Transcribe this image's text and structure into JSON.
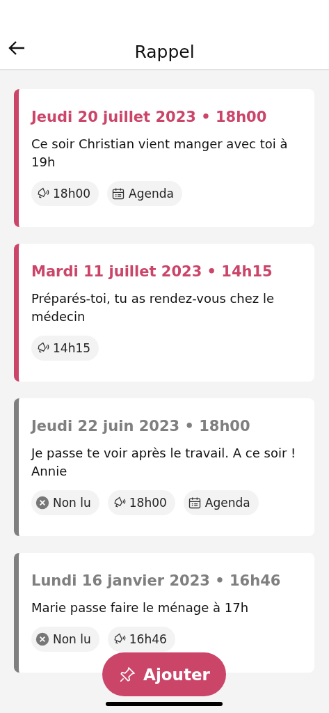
{
  "header": {
    "title": "Rappel"
  },
  "reminders": [
    {
      "date": "Jeudi 20 juillet 2023 • 18h00",
      "message": "Ce soir Christian vient manger avec toi à 19h",
      "active": true,
      "chips": [
        {
          "kind": "alarm",
          "label": "18h00"
        },
        {
          "kind": "agenda",
          "label": "Agenda"
        }
      ]
    },
    {
      "date": "Mardi 11 juillet 2023 • 14h15",
      "message": "Préparés-toi, tu as rendez-vous chez le médecin",
      "active": true,
      "chips": [
        {
          "kind": "alarm",
          "label": "14h15"
        }
      ]
    },
    {
      "date": "Jeudi 22 juin 2023 • 18h00",
      "message": "Je passe te voir après le travail.  A ce soir ! Annie",
      "active": false,
      "chips": [
        {
          "kind": "unread",
          "label": "Non lu"
        },
        {
          "kind": "alarm",
          "label": "18h00"
        },
        {
          "kind": "agenda",
          "label": "Agenda"
        }
      ]
    },
    {
      "date": "Lundi 16 janvier 2023 • 16h46",
      "message": "Marie passe faire le ménage à 17h",
      "active": false,
      "chips": [
        {
          "kind": "unread",
          "label": "Non lu"
        },
        {
          "kind": "alarm",
          "label": "16h46"
        }
      ]
    }
  ],
  "add_button": {
    "label": "Ajouter"
  }
}
